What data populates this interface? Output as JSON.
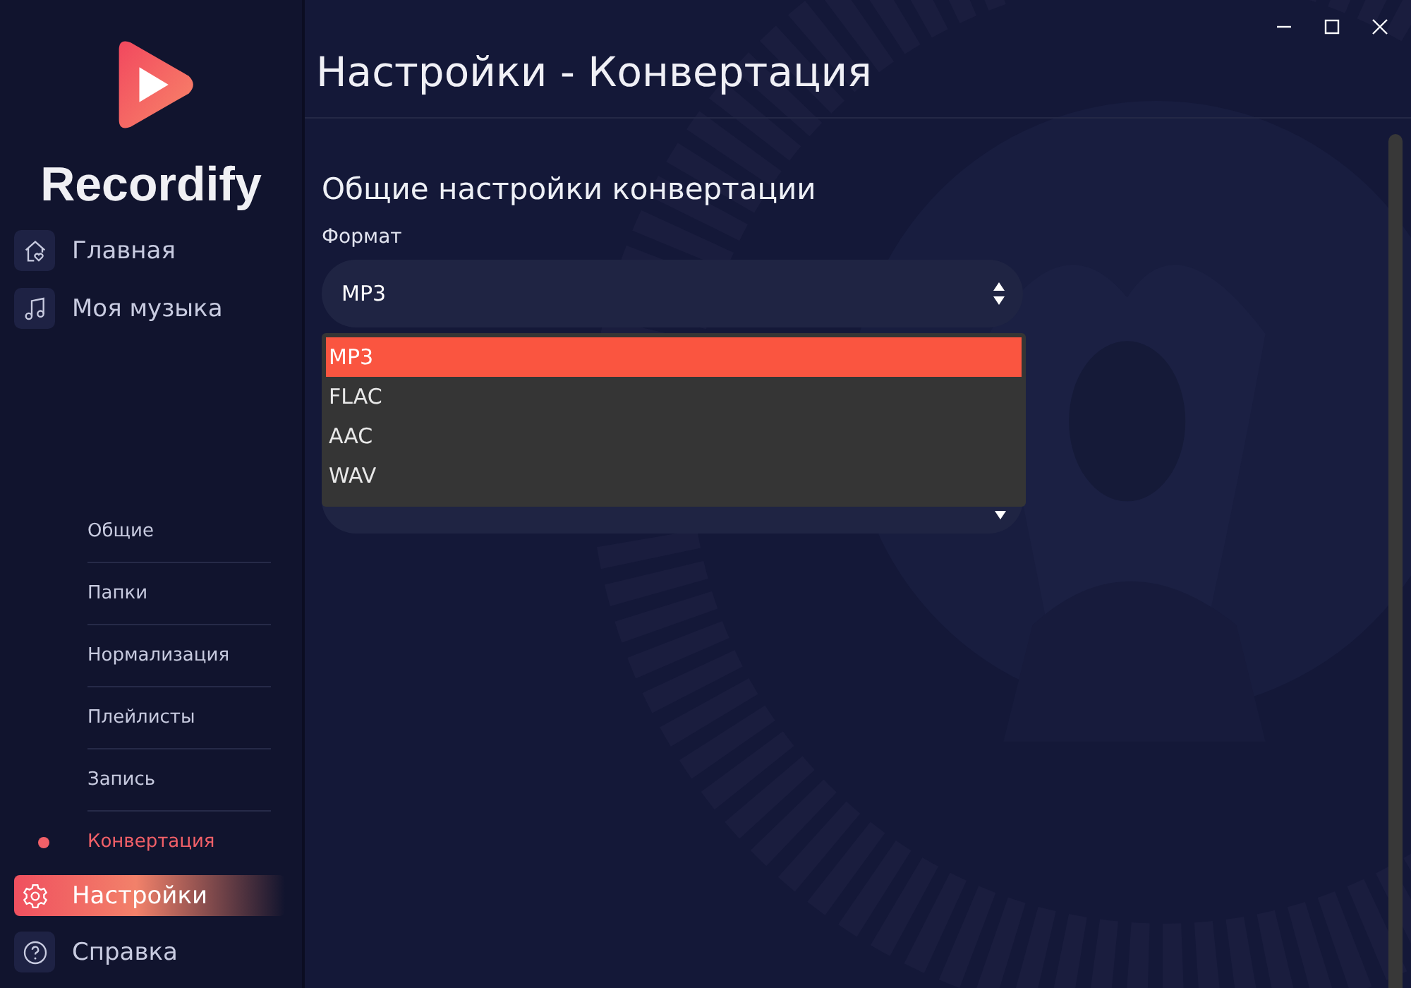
{
  "app": {
    "name": "Recordify"
  },
  "nav": [
    {
      "label": "Главная",
      "kind": "home",
      "selected": false
    },
    {
      "label": "Моя музыка",
      "kind": "music",
      "selected": false
    }
  ],
  "settings_subnav": [
    {
      "label": "Общие",
      "selected": false
    },
    {
      "label": "Папки",
      "selected": false
    },
    {
      "label": "Нормализация",
      "selected": false
    },
    {
      "label": "Плейлисты",
      "selected": false
    },
    {
      "label": "Запись",
      "selected": false
    },
    {
      "label": "Конвертация",
      "selected": true
    }
  ],
  "bottom_nav": [
    {
      "label": "Настройки",
      "kind": "settings",
      "selected": true
    },
    {
      "label": "Справка",
      "kind": "help",
      "selected": false
    }
  ],
  "page_title": "Настройки - Конвертация",
  "section_title": "Общие настройки конвертации",
  "format": {
    "label": "Формат",
    "value": "MP3",
    "expanded": true,
    "options": [
      {
        "label": "MP3",
        "selected": true
      },
      {
        "label": "FLAC",
        "selected": false
      },
      {
        "label": "AAC",
        "selected": false
      },
      {
        "label": "WAV",
        "selected": false
      }
    ]
  }
}
